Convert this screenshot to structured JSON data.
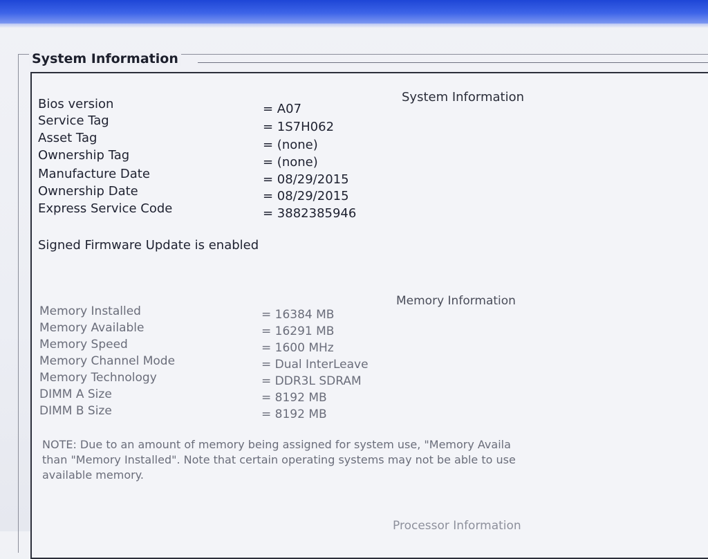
{
  "group_title": "System Information",
  "system": {
    "header": "System Information",
    "rows": [
      {
        "label": "Bios version",
        "value": "= A07"
      },
      {
        "label": "Service Tag",
        "value": "= 1S7H062"
      },
      {
        "label": "Asset Tag",
        "value": "= (none)"
      },
      {
        "label": "Ownership Tag",
        "value": "= (none)"
      },
      {
        "label": "Manufacture Date",
        "value": "= 08/29/2015"
      },
      {
        "label": "Ownership Date",
        "value": "= 08/29/2015"
      },
      {
        "label": "Express Service Code",
        "value": "= 3882385946"
      }
    ],
    "signed_firmware": "Signed Firmware Update is enabled"
  },
  "memory": {
    "header": "Memory Information",
    "rows": [
      {
        "label": "Memory Installed",
        "value": "= 16384 MB"
      },
      {
        "label": "Memory Available",
        "value": "= 16291 MB"
      },
      {
        "label": "Memory Speed",
        "value": "= 1600 MHz"
      },
      {
        "label": "Memory Channel Mode",
        "value": "= Dual InterLeave"
      },
      {
        "label": "Memory Technology",
        "value": "= DDR3L SDRAM"
      },
      {
        "label": "DIMM A Size",
        "value": "= 8192 MB"
      },
      {
        "label": "DIMM B Size",
        "value": "= 8192 MB"
      }
    ],
    "note_lines": [
      "NOTE: Due to an amount of memory being assigned for system use, \"Memory Availa",
      "than \"Memory Installed\". Note that certain operating systems may not be able to use",
      "available memory."
    ]
  },
  "processor": {
    "header": "Processor Information"
  }
}
